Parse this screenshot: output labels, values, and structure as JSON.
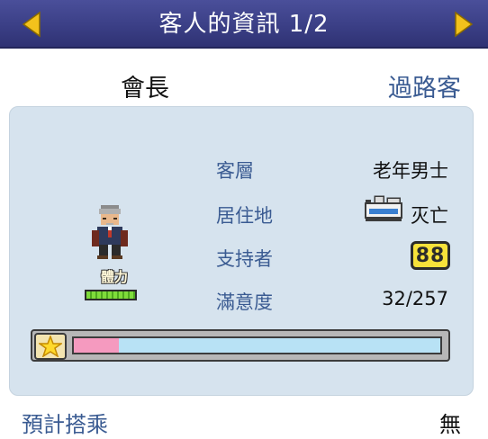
{
  "header": {
    "title": "客人的資訊 1/2",
    "prev_icon": "arrow-left-icon",
    "next_icon": "arrow-right-icon"
  },
  "guest": {
    "name": "會長",
    "type": "過路客",
    "stat_label": "體力",
    "stamina_fraction": 1.0
  },
  "details": {
    "rows": [
      {
        "label": "客層",
        "value": "老年男士"
      },
      {
        "label": "居住地",
        "value": "灭亡",
        "icon": "residence-icon"
      },
      {
        "label": "支持者",
        "value": "88"
      },
      {
        "label": "滿意度",
        "value": "32/257"
      }
    ]
  },
  "satisfaction": {
    "fraction": 0.124,
    "icon": "star-icon"
  },
  "footer": {
    "label": "預計搭乘",
    "value": "無"
  },
  "colors": {
    "header": "#3b3f86",
    "panel": "#d6e3ee",
    "accent_text": "#3a5b92",
    "progress_fill": "#f59abf",
    "progress_remaining": "#b8e2f5",
    "badge": "#f7e23a"
  }
}
